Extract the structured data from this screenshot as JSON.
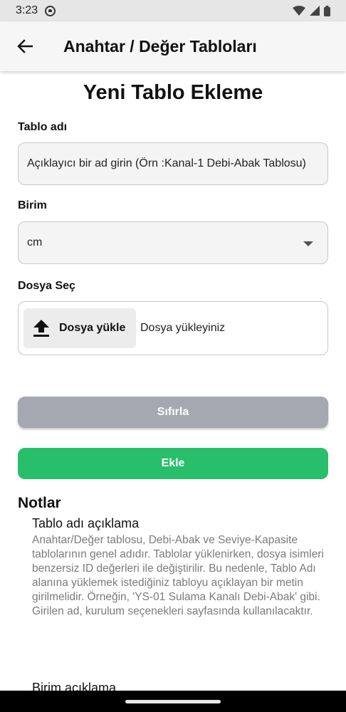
{
  "status_bar": {
    "time": "3:23"
  },
  "app_bar": {
    "title": "Anahtar / Değer Tabloları",
    "back_icon": "arrow-left-icon"
  },
  "form": {
    "title": "Yeni Tablo Ekleme",
    "table_name": {
      "label": "Tablo adı",
      "placeholder": "Açıklayıcı bir ad girin (Örn :Kanal-1 Debi-Abak Tablosu)"
    },
    "unit": {
      "label": "Birim",
      "selected": "cm"
    },
    "file": {
      "label": "Dosya Seç",
      "upload_label": "Dosya yükle",
      "status": "Dosya yükleyiniz"
    },
    "reset_label": "Sıfırla",
    "add_label": "Ekle"
  },
  "notes": {
    "title": "Notlar",
    "items": [
      {
        "heading": "Tablo adı açıklama",
        "body": "Anahtar/Değer tablosu, Debi-Abak ve Seviye-Kapasite tablolarının genel adıdır. Tablolar yüklenirken, dosya isimleri benzersiz ID değerleri ile değiştirilir. Bu nedenle, Tablo Adı alanına yüklemek istediğiniz tabloyu açıklayan bir metin girilmelidir. Örneğin, 'YS-01 Sulama Kanalı Debi-Abak' gibi. Girilen ad, kurulum seçenekleri sayfasında kullanılacaktır."
      },
      {
        "heading": "Birim açıklama",
        "body": ""
      }
    ]
  },
  "colors": {
    "add_button": "#28bf6a",
    "reset_button": "#a5a7b1"
  }
}
